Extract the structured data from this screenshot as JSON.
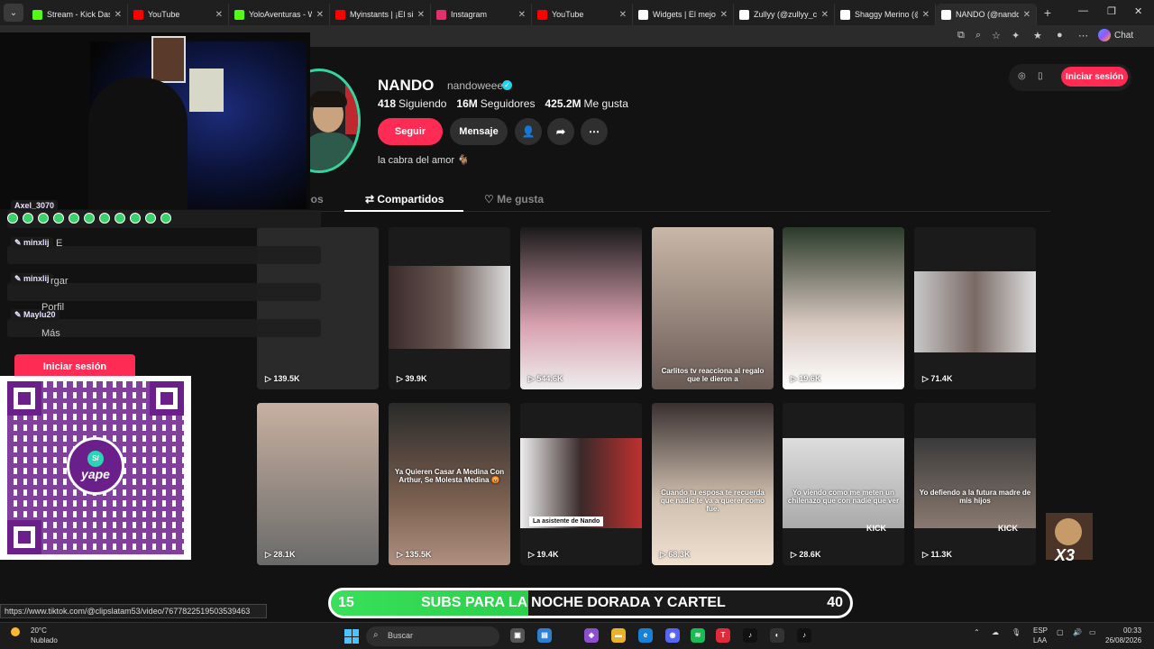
{
  "browser": {
    "tabs": [
      {
        "label": "Stream - Kick Dashb",
        "color": "#53fc18"
      },
      {
        "label": "YouTube",
        "color": "#ff0000"
      },
      {
        "label": "YoloAventuras - Wat",
        "color": "#53fc18"
      },
      {
        "label": "Myinstants | ¡El sitio",
        "color": "#ff0000"
      },
      {
        "label": "Instagram",
        "color": "#e1306c"
      },
      {
        "label": "YouTube",
        "color": "#ff0000"
      },
      {
        "label": "Widgets | El mejor s",
        "color": "#ffffff"
      },
      {
        "label": "Zullyy (@zullyy_cs) |",
        "color": "#ffffff"
      },
      {
        "label": "Shaggy Merino (@s",
        "color": "#ffffff"
      },
      {
        "label": "NANDO (@nandowe",
        "color": "#ffffff"
      }
    ],
    "chat_label": "Chat"
  },
  "profile": {
    "name": "NANDO",
    "handle": "nandoweee",
    "following_count": "418",
    "following_label": "Siguiendo",
    "followers_count": "16M",
    "followers_label": "Seguidores",
    "likes_count": "425.2M",
    "likes_label": "Me gusta",
    "follow_label": "Seguir",
    "message_label": "Mensaje",
    "bio": "la cabra del amor 🐐",
    "login_label": "Iniciar sesión"
  },
  "profile_tabs": {
    "videos": "eos",
    "shared": "Compartidos",
    "liked": "Me gusta"
  },
  "videos": [
    {
      "views": "139.5K",
      "caption": "",
      "badge": "",
      "kick": ""
    },
    {
      "views": "39.9K",
      "caption": "",
      "badge": "",
      "kick": ""
    },
    {
      "views": "544.6K",
      "caption": "",
      "badge": "",
      "kick": ""
    },
    {
      "views": "",
      "caption": "Carlitos tv reacciona al regalo que le dieron a",
      "badge": "",
      "kick": ""
    },
    {
      "views": "19.6K",
      "caption": "",
      "badge": "",
      "kick": ""
    },
    {
      "views": "71.4K",
      "caption": "",
      "badge": "",
      "kick": ""
    },
    {
      "views": "28.1K",
      "caption": "",
      "badge": "",
      "kick": ""
    },
    {
      "views": "135.5K",
      "caption": "Ya Quieren Casar A Medina Con Arthur, Se Molesta Medina 😡",
      "badge": "",
      "kick": ""
    },
    {
      "views": "19.4K",
      "caption": "",
      "badge": "La asistente de Nando",
      "kick": ""
    },
    {
      "views": "68.3K",
      "caption": "Cuando tu esposa te recuerda que nadie te va a querer como fue.",
      "badge": "",
      "kick": ""
    },
    {
      "views": "28.6K",
      "caption": "Yo viendo como me meten un chilenazo que con nadie que ver",
      "badge": "",
      "kick": "KICK"
    },
    {
      "views": "11.3K",
      "caption": "Yo defiendo a la futura madre de mis hijos",
      "badge": "",
      "kick": "KICK"
    }
  ],
  "stream_overlay": {
    "chat": [
      {
        "user": "Axel_3070",
        "text": ""
      },
      {
        "user": "minxlij",
        "text": "E"
      },
      {
        "user": "minxlij",
        "text": "rgar"
      },
      {
        "user": "Maylu20",
        "text": "Porfil"
      }
    ],
    "menu_more": "Más",
    "login_label": "Iniciar sesión",
    "yape_label": "yape",
    "x3_label": "X3",
    "subs_current": "15",
    "subs_text": "SUBS PARA LA NOCHE DORADA Y CARTEL",
    "subs_goal": "40",
    "progress": 0.375
  },
  "status_url": "https://www.tiktok.com/@clipslatam53/video/7677822519503539463",
  "taskbar": {
    "temp": "20°C",
    "weather": "Nublado",
    "search": "Buscar",
    "lang1": "ESP",
    "lang2": "LAA",
    "time": "00:33",
    "date": "26/08/2026"
  }
}
